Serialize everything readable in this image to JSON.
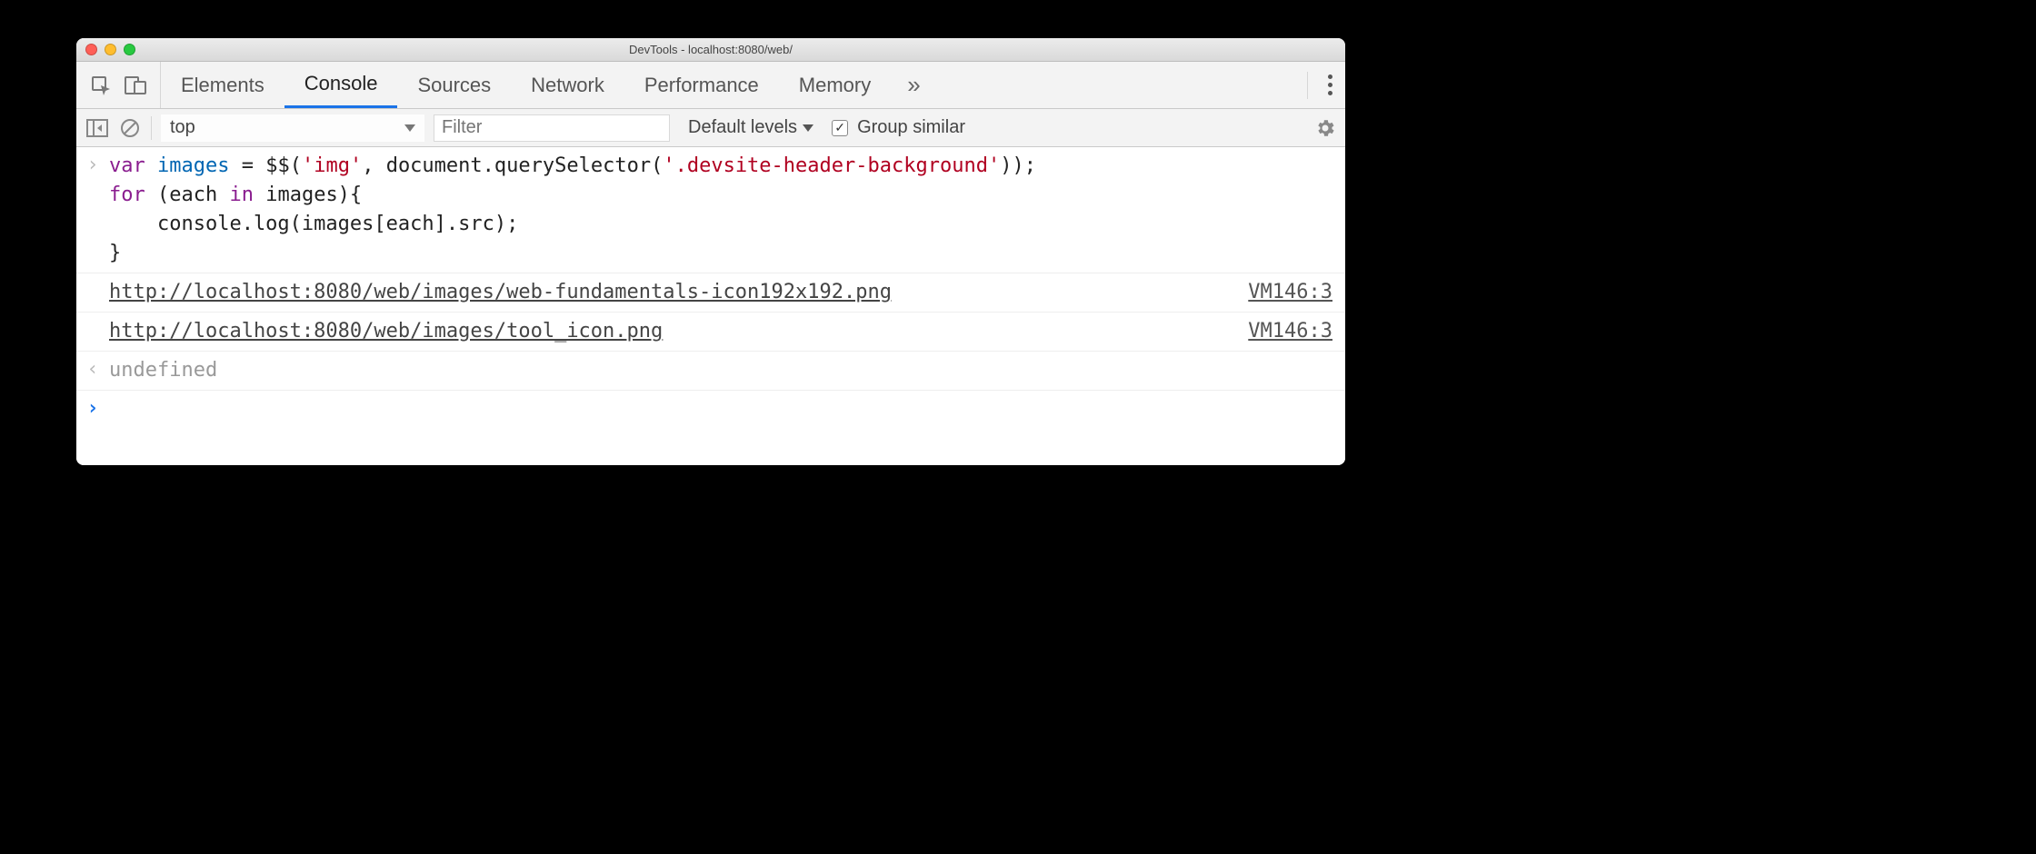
{
  "window": {
    "title": "DevTools - localhost:8080/web/"
  },
  "tabs": {
    "items": [
      "Elements",
      "Console",
      "Sources",
      "Network",
      "Performance",
      "Memory"
    ],
    "active": "Console",
    "overflow_glyph": "»"
  },
  "toolbar": {
    "context": "top",
    "filter_placeholder": "Filter",
    "levels_label": "Default levels",
    "group_similar_label": "Group similar",
    "group_similar_checked": true
  },
  "console": {
    "input_code_html": "<span class='kw'>var</span> <span class='ident'>images</span> = $$(<span class='str'>'img'</span>, document.querySelector(<span class='str'>'.devsite-header-background'</span>));\n<span class='kw'>for</span> (each <span class='kw'>in</span> images){\n    console.log(images[each].src);\n}",
    "logs": [
      {
        "text": "http://localhost:8080/web/images/web-fundamentals-icon192x192.png",
        "source": "VM146:3"
      },
      {
        "text": "http://localhost:8080/web/images/tool_icon.png",
        "source": "VM146:3"
      }
    ],
    "return_value": "undefined",
    "return_marker": "‹",
    "prompt_marker": "›",
    "new_prompt_marker": "›"
  }
}
